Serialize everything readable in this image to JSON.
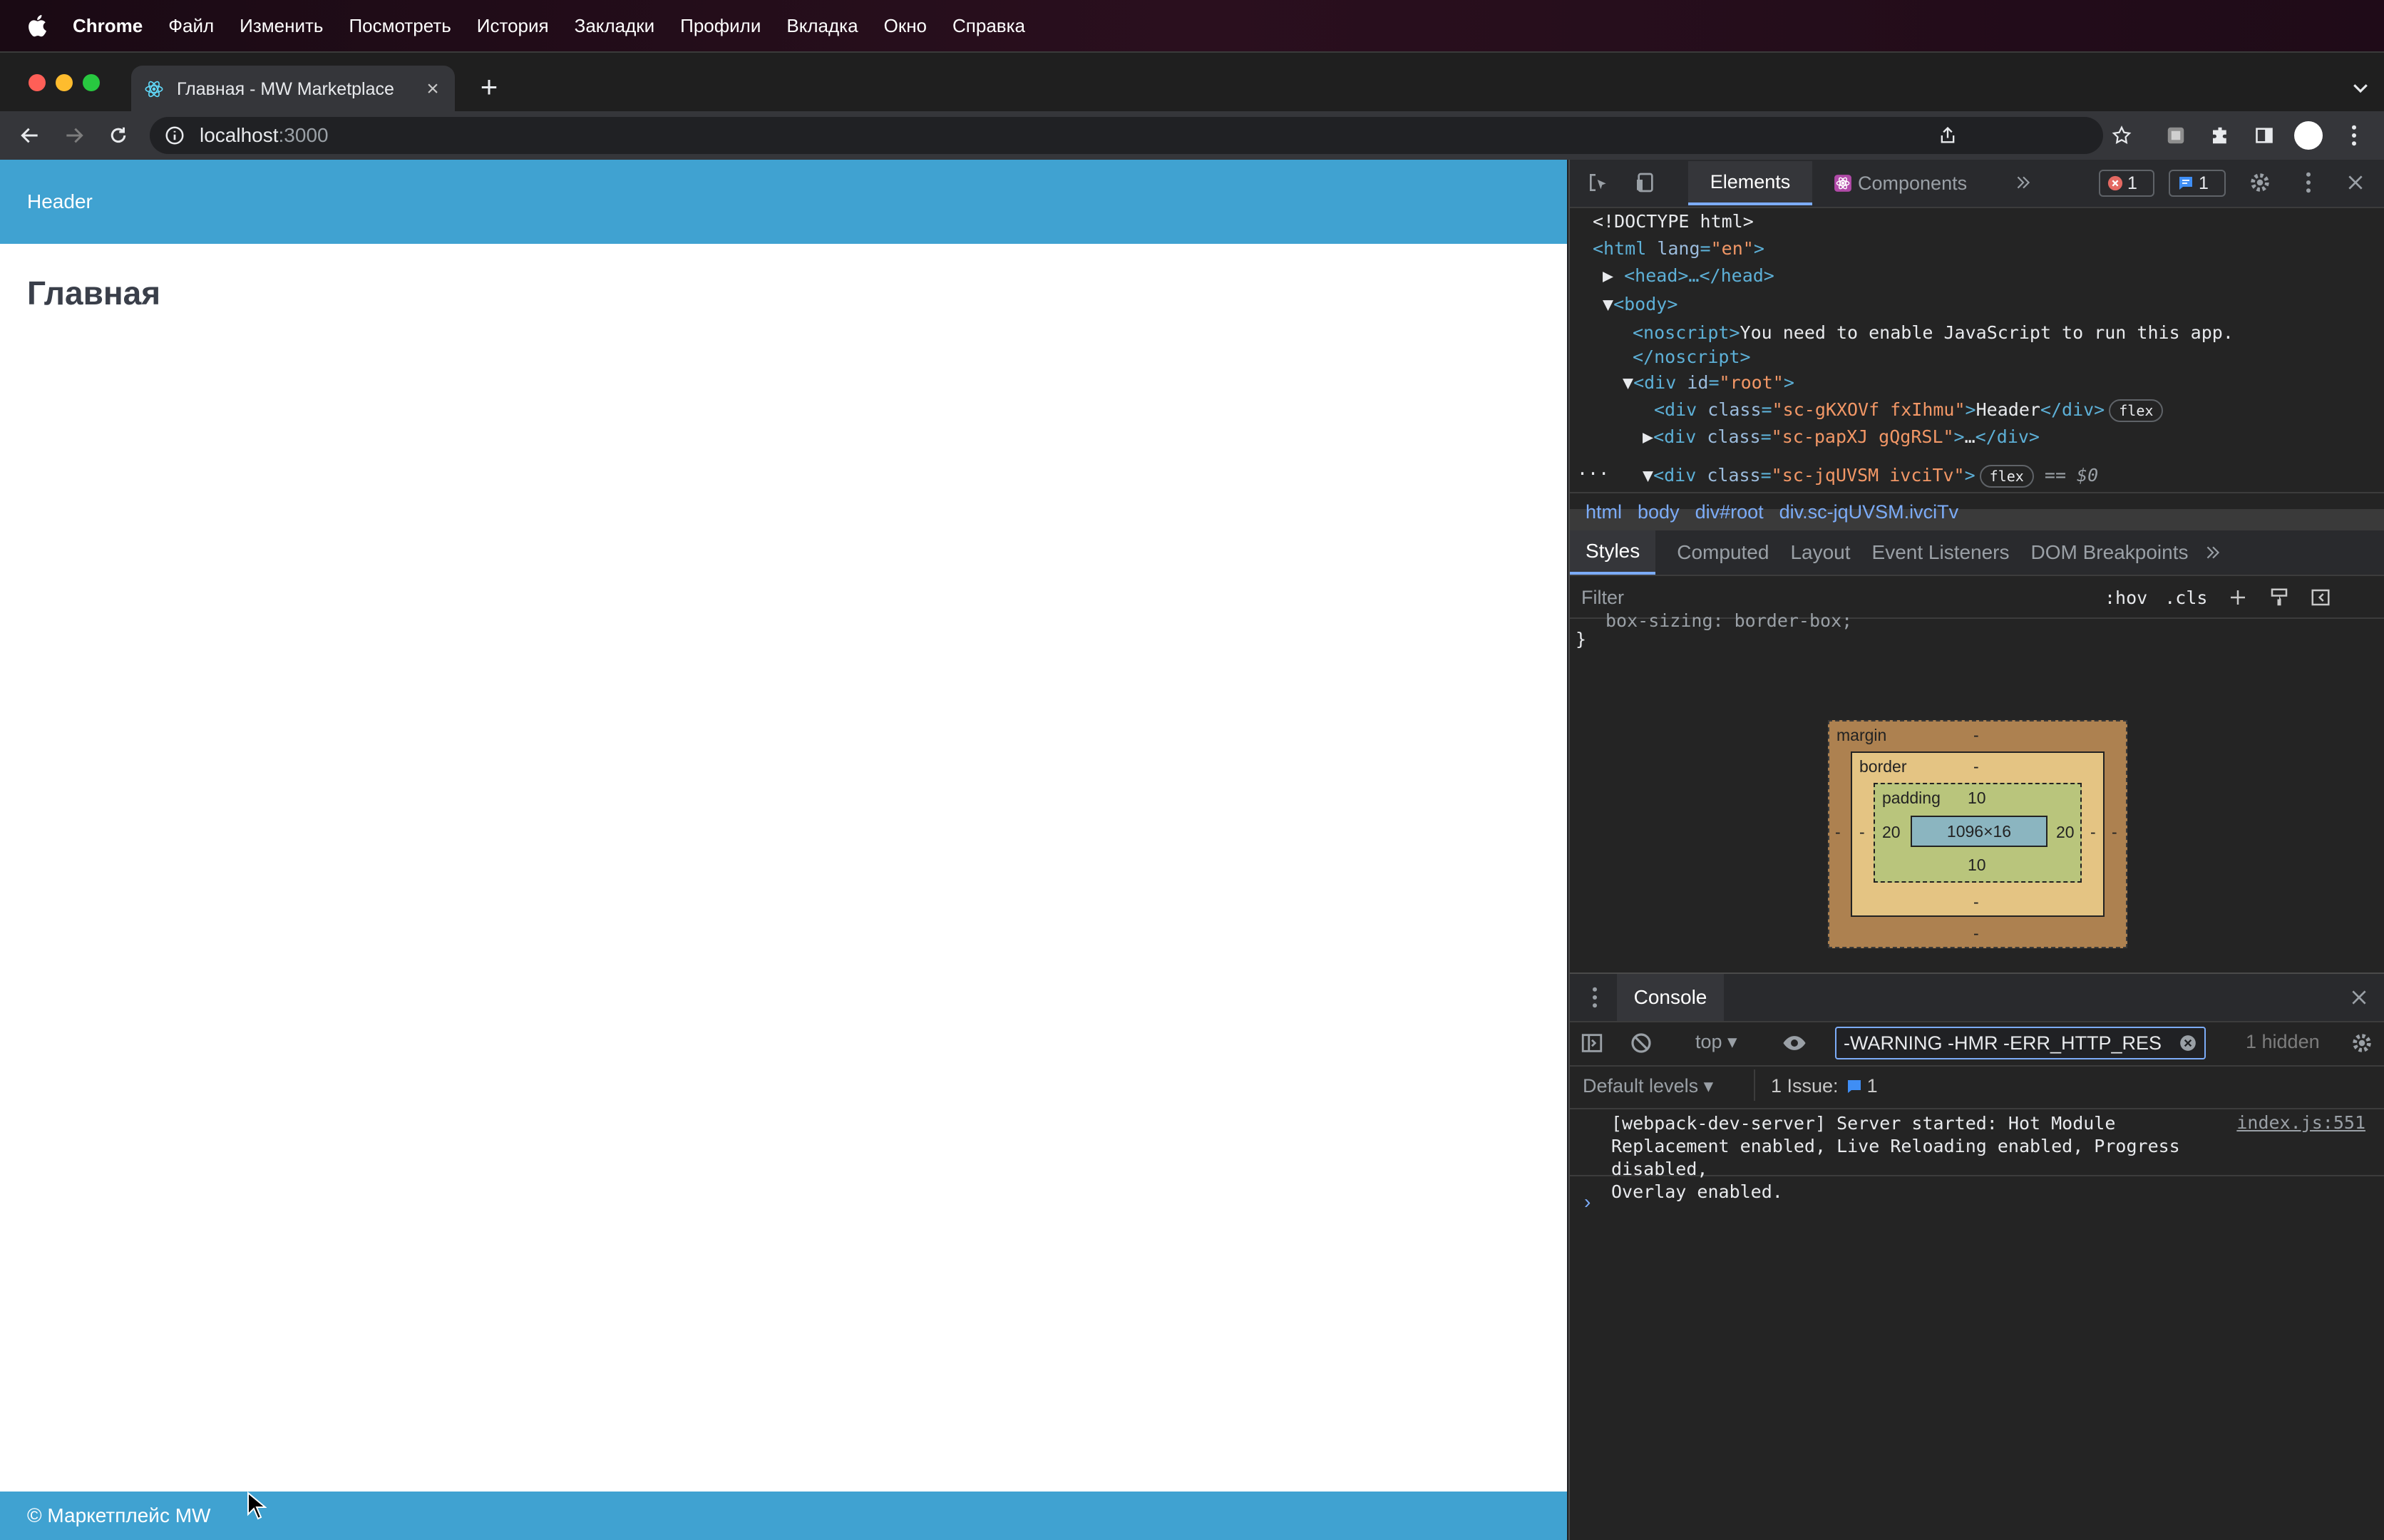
{
  "menubar": {
    "app": "Chrome",
    "items": [
      "Файл",
      "Изменить",
      "Посмотреть",
      "История",
      "Закладки",
      "Профили",
      "Вкладка",
      "Окно",
      "Справка"
    ]
  },
  "browser": {
    "tab_title": "Главная - MW Marketplace",
    "url_host": "localhost",
    "url_port": ":3000"
  },
  "page": {
    "header_text": "Header",
    "title": "Главная",
    "footer_text": "© Маркетплейс MW"
  },
  "devtools": {
    "tabs": {
      "elements": "Elements",
      "components": "Components"
    },
    "errors_count": "1",
    "messages_count": "1",
    "dom": {
      "doctype": "<!DOCTYPE html>",
      "html_open": "<html",
      "lang_attr": "lang",
      "lang_val": "\"en\"",
      "head": "<head>…</head>",
      "body_open": "<body>",
      "noscript_open": "<noscript>",
      "noscript_text": "You need to enable JavaScript to run this app.",
      "noscript_close": "</noscript>",
      "div_open": "<div",
      "id_attr": "id",
      "root_val": "\"root\"",
      "class_attr": "class",
      "header_class": "\"sc-gKXOVf fxIhmu\"",
      "header_text": "Header",
      "div_close": "</div>",
      "second_class": "\"sc-papXJ gQgRSL\"",
      "ellipsis": "…",
      "selected_class": "\"sc-jqUVSM ivciTv\"",
      "flex_badge": "flex",
      "selected_ref": "== $0",
      "gt": ">",
      "more": "···"
    },
    "breadcrumbs": [
      "html",
      "body",
      "div#root",
      "div.sc-jqUVSM.ivciTv"
    ],
    "subtabs": [
      "Styles",
      "Computed",
      "Layout",
      "Event Listeners",
      "DOM Breakpoints"
    ],
    "filter_placeholder": "Filter",
    "hov": ":hov",
    "cls": ".cls",
    "css_line": "box-sizing: border-box;",
    "css_close": "}",
    "box_model": {
      "margin_label": "margin",
      "margin_value": "-",
      "border_label": "border",
      "border_value": "-",
      "padding_label": "padding",
      "padding_top": "10",
      "padding_bottom": "10",
      "padding_left": "20",
      "padding_right": "20",
      "content": "1096×16",
      "dash": "-"
    },
    "console": {
      "tab": "Console",
      "context": "top",
      "filter_value": "-WARNING -HMR -ERR_HTTP_RES",
      "hidden": "1 hidden",
      "levels": "Default levels",
      "issues_label": "1 Issue:",
      "issues_count": "1",
      "message": "[webpack-dev-server] Server started: Hot Module\nReplacement enabled, Live Reloading enabled, Progress disabled,\nOverlay enabled.",
      "source": "index.js:551",
      "prompt": "›"
    }
  },
  "colors": {
    "app_header": "#40a2d1",
    "devtools_accent": "#7cacf8"
  }
}
